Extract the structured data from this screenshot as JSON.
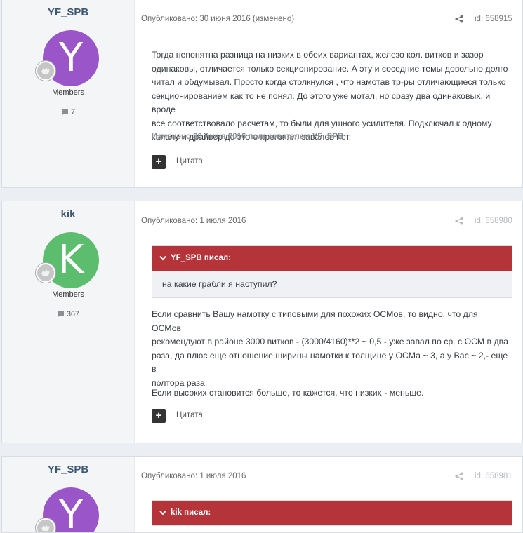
{
  "colors": {
    "avatar_purple": "#9a55c8",
    "avatar_green": "#5bbd6d",
    "quote_header": "#b5343a",
    "author_name": "#3d5771"
  },
  "posts": [
    {
      "author": "YF_SPB",
      "avatar_letter": "Y",
      "avatar_color": "#9a55c8",
      "group": "Members",
      "post_count": "7",
      "meta": "Опубликовано: 30 июня 2016 (изменено)",
      "post_id": "id: 658915",
      "body_lines": [
        "Тогда непонятна разница на низких в обеих вариантах, железо кол. витков и зазор",
        "одинаковы, отличается только секционирование. А эту и соседние темы довольно долго",
        "читал и обдумывал. Просто когда столкнулся , что намотав тр-ры отличающиеся только",
        "секционированием как то не понял. До этого уже мотал, но сразу два одинаковых, и вроде",
        "все соответствовало расчетам, то были для ушного усилителя. Подключал к одному",
        "каналу и драйвер до этого прогонял, завалов нет."
      ],
      "edited_note": "Изменено 30 июня 2016 пользователем YF_SPB",
      "add_label": "+",
      "quote_label": "Цитата"
    },
    {
      "author": "kik",
      "avatar_letter": "K",
      "avatar_color": "#5bbd6d",
      "group": "Members",
      "post_count": "367",
      "meta": "Опубликовано: 1 июля 2016",
      "post_id": "id: 658980",
      "quote_author": "YF_SPB писал:",
      "quote_text": "на какие грабли я наступил?",
      "body_lines": [
        "Если сравнить Вашу намотку с типовыми для похожих ОСМов, то видно, что для ОСМов",
        "рекомендуют в районе 3000 витков - (3000/4160)**2 ~ 0,5 - уже завал по ср. с ОСМ в два",
        "раза, да плюс еще отношение ширины намотки к толщине у ОСМа ~ 3, а у Вас ~ 2,- еще в",
        "полтора раза."
      ],
      "body_line_2": "Если высоких становится больше, то кажется, что низких - меньше.",
      "add_label": "+",
      "quote_label": "Цитата"
    },
    {
      "author": "YF_SPB",
      "avatar_letter": "Y",
      "avatar_color": "#9a55c8",
      "meta": "Опубликовано: 1 июля 2016",
      "post_id": "id: 658981",
      "quote_author": "kik писал:"
    }
  ]
}
